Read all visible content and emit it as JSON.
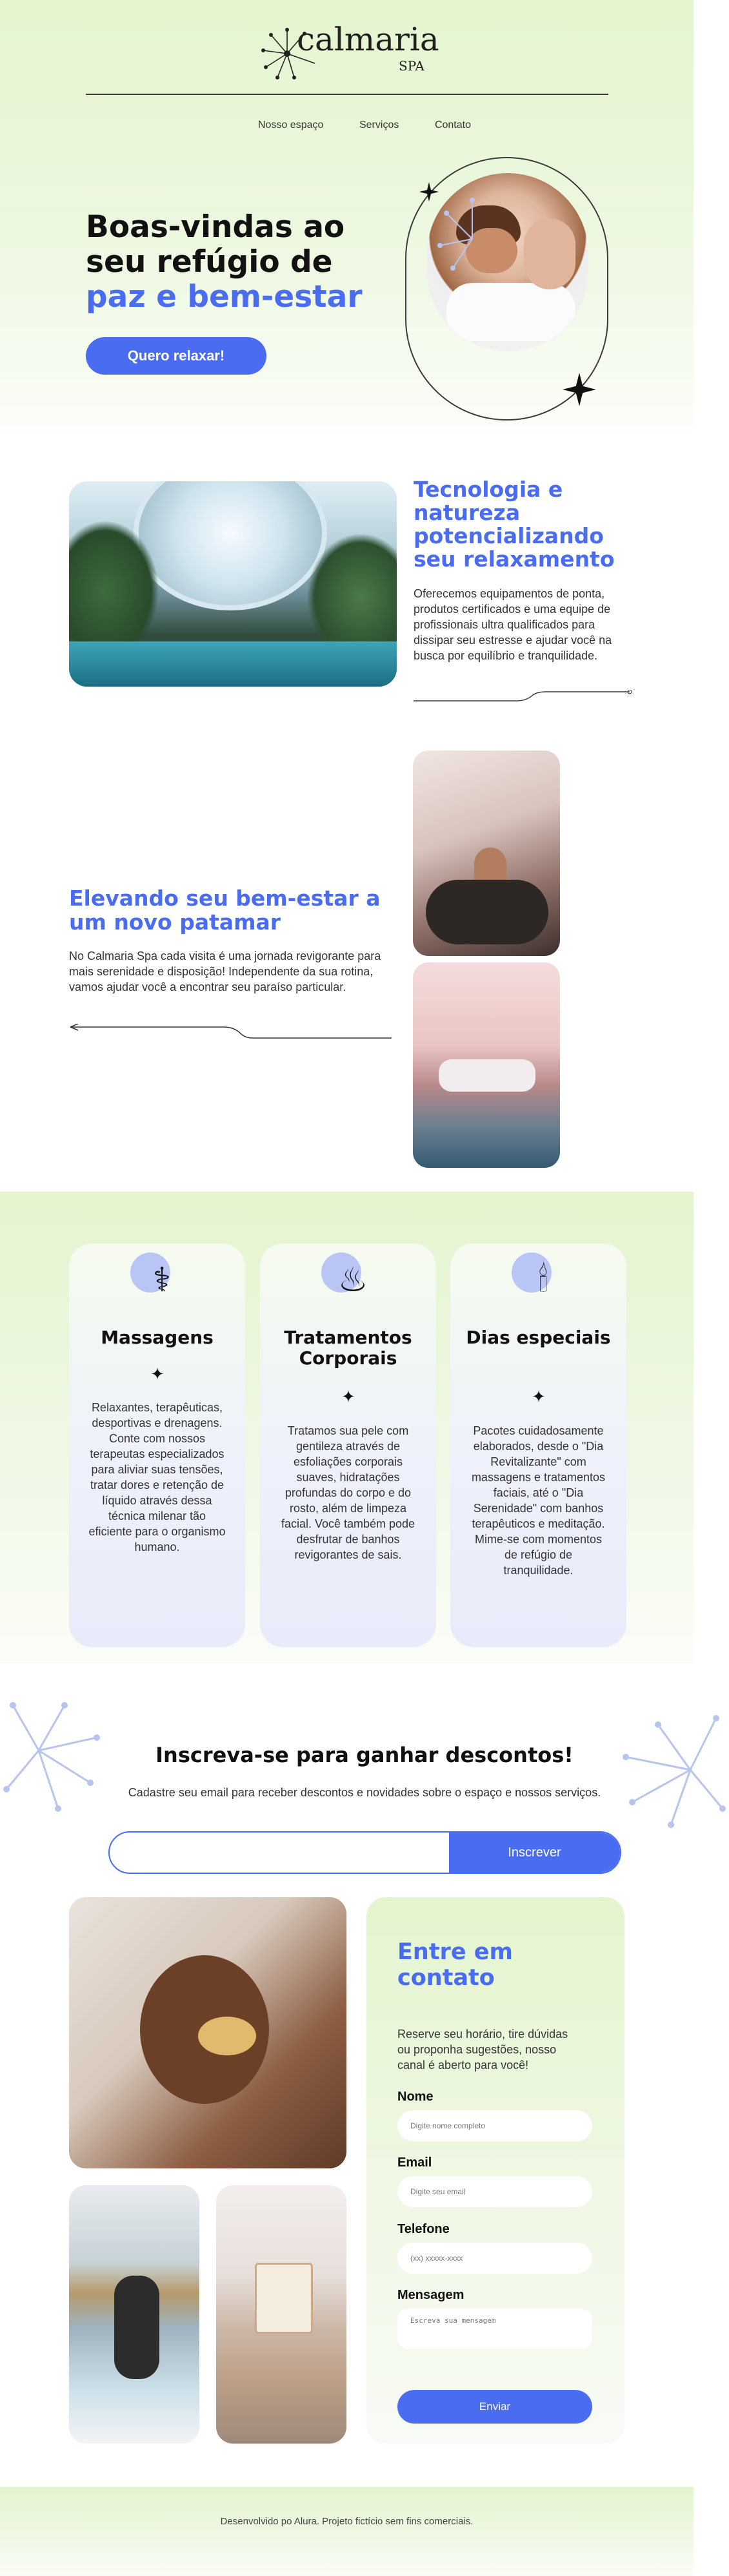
{
  "brand": {
    "name": "calmaria",
    "suffix": "SPA"
  },
  "nav": {
    "items": [
      "Nosso espaço",
      "Serviços",
      "Contato"
    ]
  },
  "hero": {
    "title_line1": "Boas-vindas ao",
    "title_line2": "seu refúgio de",
    "title_accent": "paz e bem-estar",
    "cta_label": "Quero relaxar!"
  },
  "about": {
    "title": "Tecnologia e natureza potencializando seu relaxamento",
    "text": "Oferecemos equipamentos de ponta, produtos certificados e uma equipe de profissionais ultra qualificados para dissipar seu estresse e ajudar você na busca por equilíbrio e tranquilidade."
  },
  "wellness": {
    "title": "Elevando seu bem-estar a um novo patamar",
    "text": "No Calmaria Spa cada visita é uma jornada revigorante para mais serenidade e disposição! Independente da sua rotina, vamos ajudar você a encontrar seu paraíso particular."
  },
  "services": [
    {
      "icon": "massage-icon",
      "title": "Massagens",
      "text": "Relaxantes, terapêuticas, desportivas e drenagens. Conte com nossos terapeutas especializados para aliviar suas tensões, tratar dores e retenção de líquido através dessa técnica milenar tão eficiente para o organismo humano."
    },
    {
      "icon": "bathtub-icon",
      "title": "Tratamentos Corporais",
      "text": "Tratamos sua pele com gentileza através de esfoliações corporais suaves, hidratações profundas do corpo e do rosto, além de limpeza facial. Você também pode desfrutar de banhos revigorantes de sais."
    },
    {
      "icon": "candles-icon",
      "title": "Dias especiais",
      "text": "Pacotes cuidadosamente elaborados, desde o \"Dia Revitalizante\" com massagens e tratamentos faciais, até o \"Dia Serenidade\" com banhos terapêuticos e meditação. Mime-se com momentos de refúgio de tranquilidade."
    }
  ],
  "newsletter": {
    "title": "Inscreva-se para ganhar descontos!",
    "text": "Cadastre seu email para receber descontos e novidades sobre o espaço e nossos serviços.",
    "input_value": "",
    "button_label": "Inscrever"
  },
  "contact": {
    "title": "Entre em contato",
    "text": "Reserve seu horário, tire dúvidas ou proponha sugestões, nosso canal é aberto para você!",
    "fields": {
      "name_label": "Nome",
      "name_placeholder": "Digite nome completo",
      "email_label": "Email",
      "email_placeholder": "Digite seu email",
      "phone_label": "Telefone",
      "phone_placeholder": "(xx) xxxxx-xxxx",
      "message_label": "Mensagem",
      "message_placeholder": "Escreva sua mensagem"
    },
    "submit_label": "Enviar"
  },
  "footer": {
    "text": "Desenvolvido po Alura. Projeto fictício sem fins comerciais."
  },
  "colors": {
    "accent": "#4a6cf0",
    "green_bg": "#e4f5cf",
    "text_dark": "#111111"
  }
}
